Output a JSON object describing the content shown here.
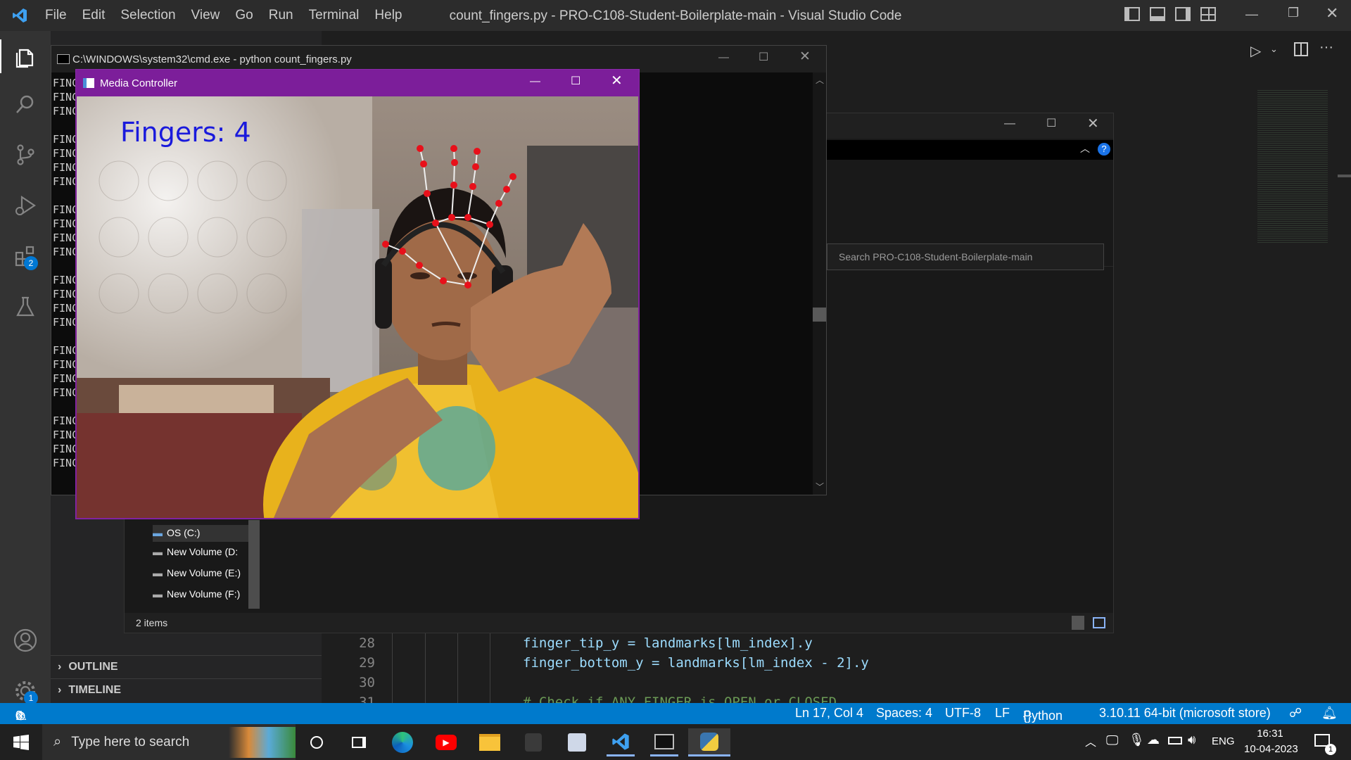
{
  "vscode": {
    "menu": [
      "File",
      "Edit",
      "Selection",
      "View",
      "Go",
      "Run",
      "Terminal",
      "Help"
    ],
    "title": "count_fingers.py - PRO-C108-Student-Boilerplate-main - Visual Studio Code",
    "sidebar_sections": [
      "OUTLINE",
      "TIMELINE"
    ],
    "extensions_badge": "2",
    "settings_badge": "1",
    "code_lines": [
      {
        "num": "28",
        "text": "finger_tip_y = landmarks[lm_index].y"
      },
      {
        "num": "29",
        "text": "finger_bottom_y = landmarks[lm_index - 2].y"
      },
      {
        "num": "30",
        "text": ""
      },
      {
        "num": "31",
        "text": "# Check if ANY FINGER is OPEN or CLOSED"
      }
    ]
  },
  "status": {
    "errors": "0",
    "warnings": "0",
    "position": "Ln 17, Col 4",
    "spaces": "Spaces: 4",
    "encoding": "UTF-8",
    "eol": "LF",
    "language": "Python",
    "interpreter": "3.10.11 64-bit (microsoft store)"
  },
  "cmd": {
    "title": "C:\\WINDOWS\\system32\\cmd.exe - python  count_fingers.py",
    "lines": [
      "FINC",
      "FINC",
      "FINC",
      "",
      "FINC",
      "FINC",
      "FINC",
      "FINC",
      "",
      "FINC",
      "FINC",
      "FINC",
      "FINC",
      "",
      "FINC",
      "FINC",
      "FINC",
      "FINC",
      "",
      "FINC",
      "FINC",
      "FINC",
      "FINC",
      "",
      "FINC",
      "FINC",
      "FINC",
      "FINC"
    ]
  },
  "explorer": {
    "search_placeholder": "Search PRO-C108-Student-Boilerplate-main",
    "drives": [
      "OS (C:)",
      "New Volume (D:",
      "New Volume (E:)",
      "New Volume (F:)"
    ],
    "item_count": "2 items"
  },
  "media": {
    "title": "Media Controller",
    "overlay": "Fingers: 4"
  },
  "taskbar": {
    "search_placeholder": "Type here to search",
    "language": "ENG",
    "time": "16:31",
    "date": "10-04-2023",
    "notif_count": "1"
  },
  "colors": {
    "accent": "#007acc",
    "media_titlebar": "#7c1e9a",
    "landmark": "#e8101a",
    "overlay_text": "#1a1adc"
  }
}
